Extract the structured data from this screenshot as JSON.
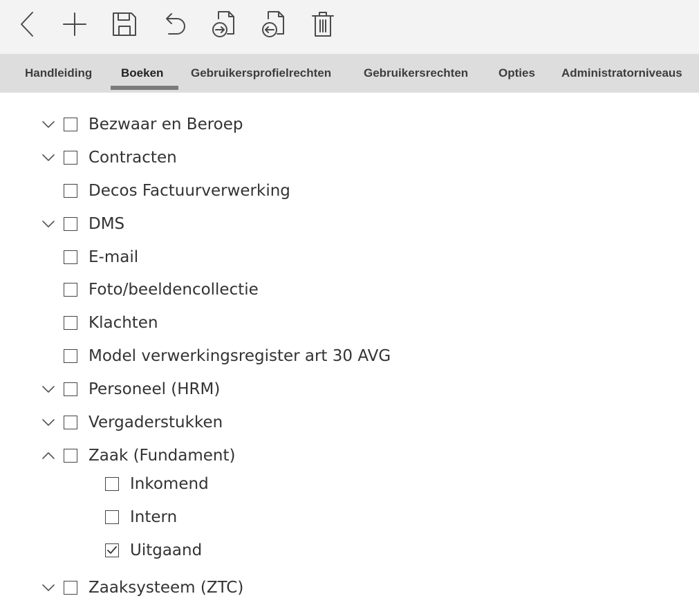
{
  "toolbar": {
    "buttons": [
      {
        "name": "back",
        "icon": "chevron-left-icon"
      },
      {
        "name": "add",
        "icon": "plus-icon"
      },
      {
        "name": "save",
        "icon": "save-icon"
      },
      {
        "name": "undo",
        "icon": "undo-icon"
      },
      {
        "name": "import",
        "icon": "file-import-icon"
      },
      {
        "name": "export",
        "icon": "file-export-icon"
      },
      {
        "name": "delete",
        "icon": "trash-icon"
      }
    ]
  },
  "tabs": [
    {
      "label": "Handleiding",
      "active": false
    },
    {
      "label": "Boeken",
      "active": true
    },
    {
      "label": "Gebruikersprofielrechten",
      "active": false
    },
    {
      "label": "Gebruikersrechten",
      "active": false
    },
    {
      "label": "Opties",
      "active": false
    },
    {
      "label": "Administratorniveaus",
      "active": false
    }
  ],
  "tree": {
    "items": [
      {
        "label": "Bezwaar en Beroep",
        "expander": "collapsed",
        "checked": false
      },
      {
        "label": "Contracten",
        "expander": "collapsed",
        "checked": false
      },
      {
        "label": "Decos Factuurverwerking",
        "expander": "none",
        "checked": false
      },
      {
        "label": "DMS",
        "expander": "collapsed",
        "checked": false
      },
      {
        "label": "E-mail",
        "expander": "none",
        "checked": false
      },
      {
        "label": "Foto/beeldencollectie",
        "expander": "none",
        "checked": false
      },
      {
        "label": "Klachten",
        "expander": "none",
        "checked": false
      },
      {
        "label": "Model verwerkingsregister art 30 AVG",
        "expander": "none",
        "checked": false
      },
      {
        "label": "Personeel (HRM)",
        "expander": "collapsed",
        "checked": false
      },
      {
        "label": "Vergaderstukken",
        "expander": "collapsed",
        "checked": false
      },
      {
        "label": "Zaak (Fundament)",
        "expander": "expanded",
        "checked": false,
        "children": [
          {
            "label": "Inkomend",
            "checked": false
          },
          {
            "label": "Intern",
            "checked": false
          },
          {
            "label": "Uitgaand",
            "checked": true
          }
        ]
      },
      {
        "label": "Zaaksysteem (ZTC)",
        "expander": "collapsed",
        "checked": false
      }
    ]
  },
  "colors": {
    "toolbar_bg": "#f3f3f3",
    "tabbar_bg": "#dddddd",
    "active_underline": "#7b7b7b",
    "text": "#333333"
  }
}
